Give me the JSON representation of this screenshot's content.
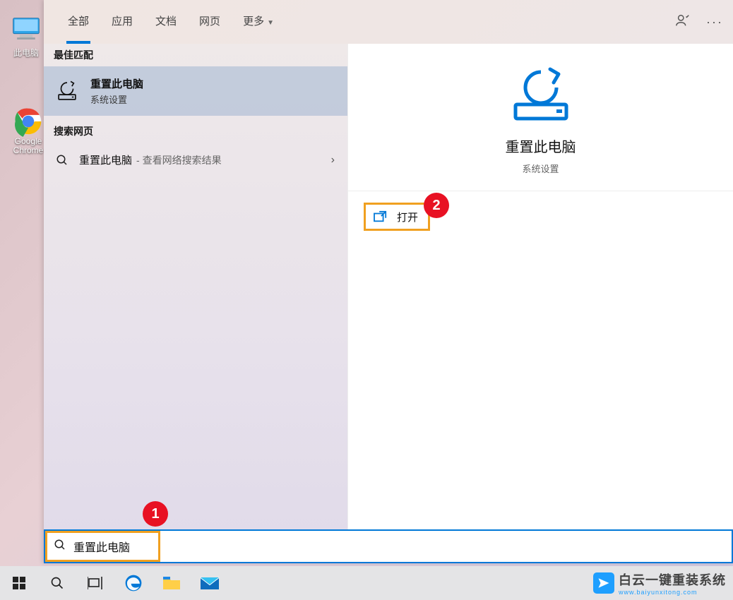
{
  "desktop": {
    "pc_label": "此电脑",
    "chrome_label": "Google Chrome"
  },
  "tabs": {
    "all": "全部",
    "apps": "应用",
    "docs": "文档",
    "web": "网页",
    "more": "更多"
  },
  "sections": {
    "best_match": "最佳匹配",
    "web_search": "搜索网页"
  },
  "best_match": {
    "title": "重置此电脑",
    "subtitle": "系统设置"
  },
  "web_row": {
    "title": "重置此电脑",
    "subtitle": "- 查看网络搜索结果"
  },
  "preview": {
    "title": "重置此电脑",
    "subtitle": "系统设置",
    "open_label": "打开"
  },
  "annotations": {
    "one": "1",
    "two": "2"
  },
  "search": {
    "value": "重置此电脑"
  },
  "watermark": {
    "title": "白云一键重装系统",
    "url": "www.baiyunxitong.com"
  }
}
